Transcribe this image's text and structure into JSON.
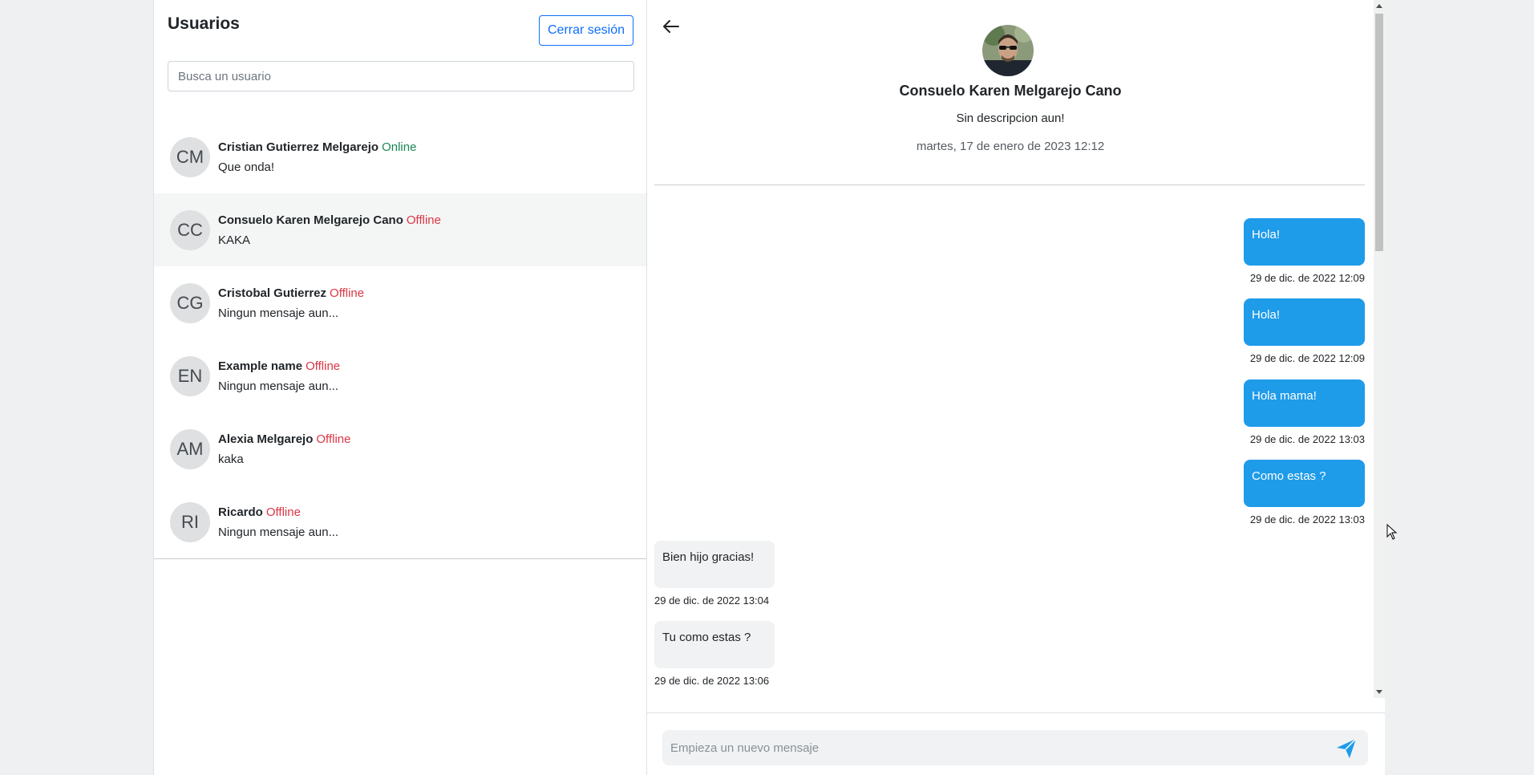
{
  "left": {
    "title": "Usuarios",
    "logout_label": "Cerrar sesión",
    "search_placeholder": "Busca un usuario",
    "users": [
      {
        "initials": "CM",
        "name": "Cristian Gutierrez Melgarejo",
        "status": "Online",
        "last_message": "Que onda!"
      },
      {
        "initials": "CC",
        "name": "Consuelo Karen Melgarejo Cano",
        "status": "Offline",
        "last_message": "KAKA"
      },
      {
        "initials": "CG",
        "name": "Cristobal Gutierrez",
        "status": "Offline",
        "last_message": "Ningun mensaje aun..."
      },
      {
        "initials": "EN",
        "name": "Example name",
        "status": "Offline",
        "last_message": "Ningun mensaje aun..."
      },
      {
        "initials": "AM",
        "name": "Alexia Melgarejo",
        "status": "Offline",
        "last_message": "kaka"
      },
      {
        "initials": "RI",
        "name": "Ricardo",
        "status": "Offline",
        "last_message": "Ningun mensaje aun..."
      }
    ]
  },
  "chat": {
    "contact_name": "Consuelo Karen Melgarejo Cano",
    "contact_description": "Sin descripcion aun!",
    "contact_last_seen": "martes, 17 de enero de 2023 12:12",
    "messages": [
      {
        "direction": "sent",
        "text": "Hola!",
        "time": "29 de dic. de 2022 12:09"
      },
      {
        "direction": "sent",
        "text": "Hola!",
        "time": "29 de dic. de 2022 12:09"
      },
      {
        "direction": "sent",
        "text": "Hola mama!",
        "time": "29 de dic. de 2022 13:03"
      },
      {
        "direction": "sent",
        "text": "Como estas ?",
        "time": "29 de dic. de 2022 13:03"
      },
      {
        "direction": "received",
        "text": "Bien hijo gracias!",
        "time": "29 de dic. de 2022 13:04"
      },
      {
        "direction": "received",
        "text": "Tu como estas ?",
        "time": "29 de dic. de 2022 13:06"
      }
    ],
    "composer_placeholder": "Empieza un nuevo mensaje"
  },
  "colors": {
    "accent": "#0d6efd",
    "sent_bubble": "#1e9be9",
    "received_bubble": "#f0f2f3",
    "online": "#198754",
    "offline": "#dc3545"
  },
  "icons": {
    "back": "arrow-left-icon",
    "send": "send-icon"
  }
}
